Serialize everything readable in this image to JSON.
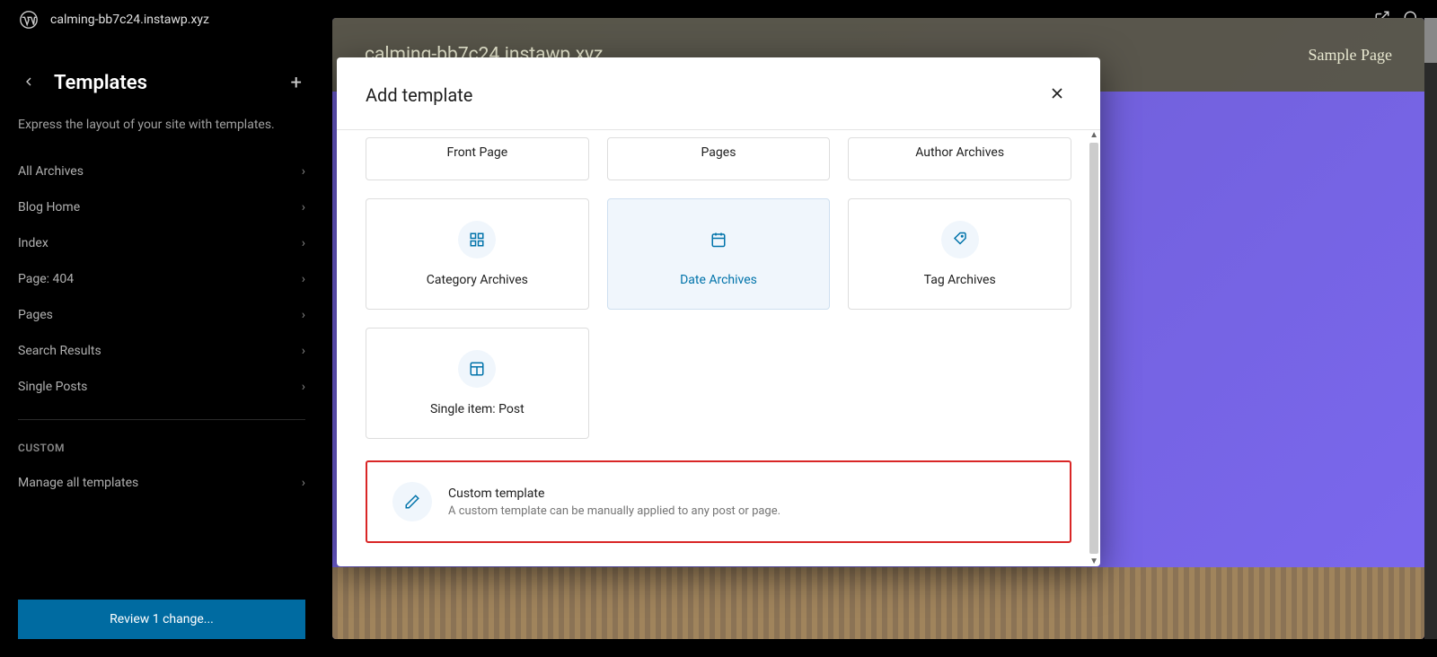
{
  "topbar": {
    "site": "calming-bb7c24.instawp.xyz"
  },
  "sidebar": {
    "title": "Templates",
    "desc": "Express the layout of your site with templates.",
    "items": [
      {
        "label": "All Archives"
      },
      {
        "label": "Blog Home"
      },
      {
        "label": "Index"
      },
      {
        "label": "Page: 404"
      },
      {
        "label": "Pages"
      },
      {
        "label": "Search Results"
      },
      {
        "label": "Single Posts"
      }
    ],
    "custom_label": "CUSTOM",
    "manage": "Manage all templates",
    "review": "Review 1 change..."
  },
  "canvas": {
    "site": "calming-bb7c24.instawp.xyz",
    "nav": "Sample Page"
  },
  "modal": {
    "title": "Add template",
    "row1": [
      {
        "label": "Front Page"
      },
      {
        "label": "Pages"
      },
      {
        "label": "Author Archives"
      }
    ],
    "row2": [
      {
        "label": "Category Archives",
        "icon": "grid"
      },
      {
        "label": "Date Archives",
        "icon": "calendar",
        "hover": true
      },
      {
        "label": "Tag Archives",
        "icon": "tag"
      }
    ],
    "row3": [
      {
        "label": "Single item: Post",
        "icon": "layout"
      }
    ],
    "custom": {
      "title": "Custom template",
      "desc": "A custom template can be manually applied to any post or page."
    }
  }
}
